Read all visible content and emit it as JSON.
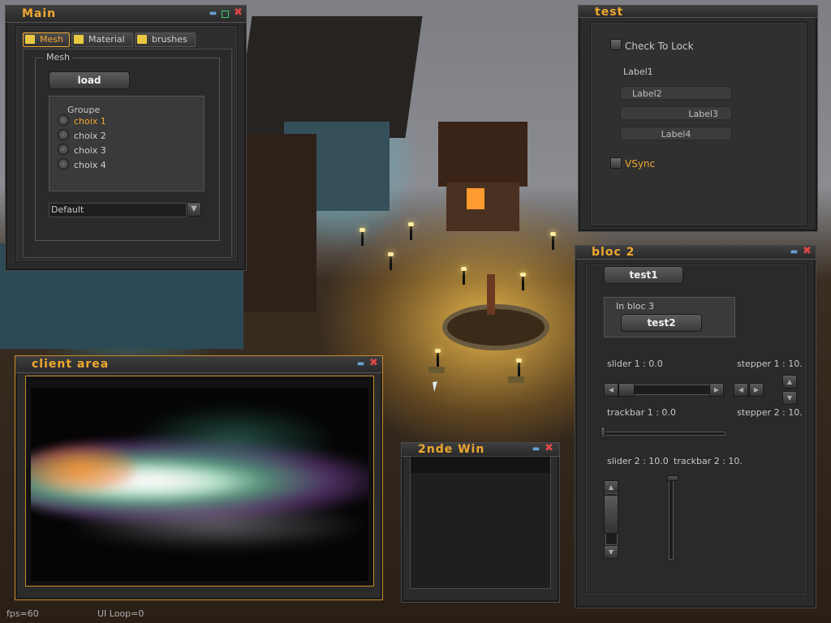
{
  "main_window": {
    "title": "Main",
    "tabs": [
      {
        "label": "Mesh",
        "icon": "mesh-tab-icon",
        "active": true
      },
      {
        "label": "Material",
        "icon": "material-tab-icon",
        "active": false
      },
      {
        "label": "brushes",
        "icon": "brushes-tab-icon",
        "active": false
      }
    ],
    "group_title": "Mesh",
    "load_button": "load",
    "radio_group_title": "Groupe",
    "radio_options": [
      "choix 1",
      "choix 2",
      "choix 3",
      "choix 4"
    ],
    "selected_option": "choix 1",
    "dropdown_value": "Default"
  },
  "test_window": {
    "title": "test",
    "checkbox_lock": "Check To Lock",
    "label1": "Label1",
    "label2": "Label2",
    "label3": "Label3",
    "label4": "Label4",
    "checkbox_vsync": "VSync"
  },
  "bloc2_window": {
    "title": "bloc 2",
    "test1_button": "test1",
    "bloc3_label": "In bloc 3",
    "test2_button": "test2",
    "slider1_label": "slider 1 : 0.0",
    "stepper1_label": "stepper 1 : 10.",
    "trackbar1_label": "trackbar 1 : 0.0",
    "stepper2_label": "stepper 2 : 10.",
    "slider2_label": "slider 2 : 10.0",
    "trackbar2_label": "trackbar 2 : 10."
  },
  "client_window": {
    "title": "client area"
  },
  "second_window": {
    "title": "2nde Win"
  },
  "status_bar": {
    "fps": "fps=60",
    "ui_loop": "UI Loop=0"
  },
  "colors": {
    "accent": "#f0a830",
    "close": "#e04848",
    "minimize": "#6aa0d0",
    "maximize": "#3cd070"
  }
}
